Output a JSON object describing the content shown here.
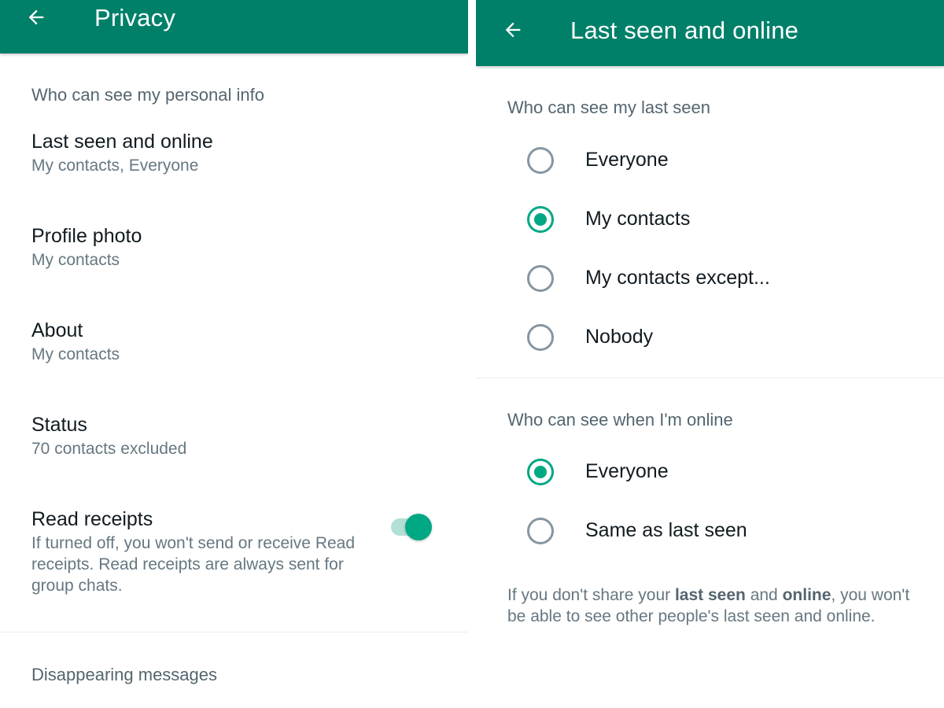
{
  "colors": {
    "appbar": "#008069",
    "accent": "#00a884",
    "text_primary": "#111b21",
    "text_secondary": "#667781"
  },
  "left": {
    "back_icon": "arrow-left-icon",
    "title": "Privacy",
    "section_personal": "Who can see my personal info",
    "items": [
      {
        "title": "Last seen and online",
        "subtitle": "My contacts, Everyone"
      },
      {
        "title": "Profile photo",
        "subtitle": "My contacts"
      },
      {
        "title": "About",
        "subtitle": "My contacts"
      },
      {
        "title": "Status",
        "subtitle": "70 contacts excluded"
      }
    ],
    "read_receipts": {
      "title": "Read receipts",
      "subtitle": "If turned off, you won't send or receive Read receipts. Read receipts are always sent for group chats.",
      "enabled": true
    },
    "section_disappearing": "Disappearing messages"
  },
  "right": {
    "back_icon": "arrow-left-icon",
    "title": "Last seen and online",
    "last_seen": {
      "header": "Who can see my last seen",
      "options": [
        "Everyone",
        "My contacts",
        "My contacts except...",
        "Nobody"
      ],
      "selected": "My contacts"
    },
    "online": {
      "header": "Who can see when I'm online",
      "options": [
        "Everyone",
        "Same as last seen"
      ],
      "selected": "Everyone"
    },
    "footnote": {
      "part1": "If you don't share your ",
      "bold1": "last seen",
      "part2": " and ",
      "bold2": "online",
      "part3": ", you won't be able to see other people's last seen and online."
    }
  }
}
